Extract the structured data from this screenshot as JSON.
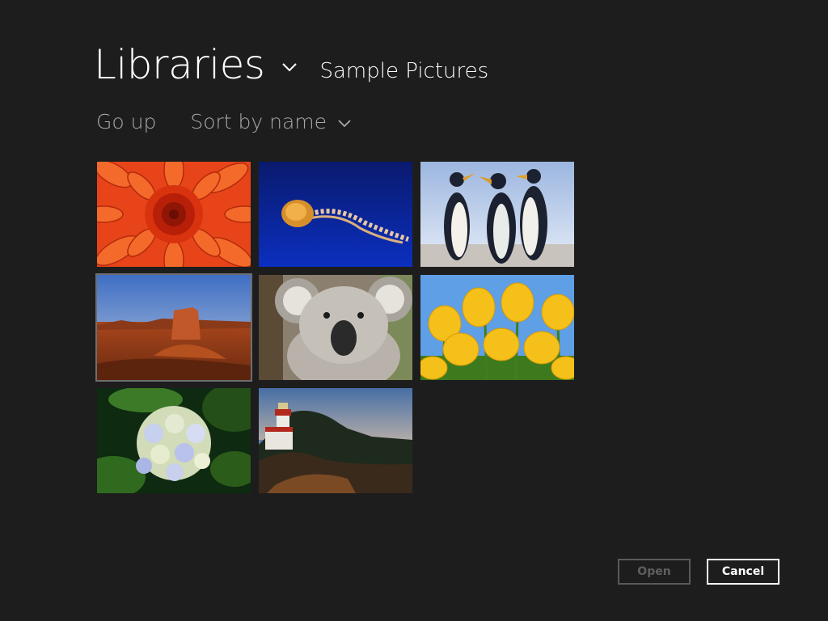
{
  "header": {
    "library_title": "Libraries",
    "location_title": "Sample Pictures"
  },
  "toolbar": {
    "go_up_label": "Go up",
    "sort_label": "Sort by name"
  },
  "pictures": [
    {
      "name": "Chrysanthemum",
      "selected": false
    },
    {
      "name": "Jellyfish",
      "selected": false
    },
    {
      "name": "Penguins",
      "selected": false
    },
    {
      "name": "Desert",
      "selected": true
    },
    {
      "name": "Koala",
      "selected": false
    },
    {
      "name": "Tulips",
      "selected": false
    },
    {
      "name": "Hydrangeas",
      "selected": false
    },
    {
      "name": "Lighthouse",
      "selected": false
    }
  ],
  "actions": {
    "open_label": "Open",
    "cancel_label": "Cancel"
  },
  "colors": {
    "background": "#1d1d1d",
    "text_primary": "#ffffff",
    "text_secondary": "#a8a8a8",
    "disabled": "#5f5f5f"
  }
}
